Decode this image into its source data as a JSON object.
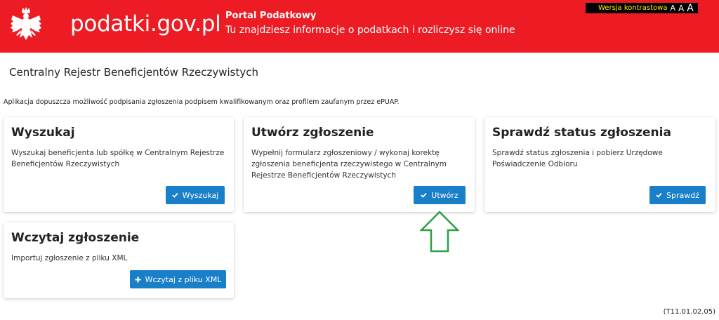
{
  "header": {
    "site_name": "podatki.gov.pl",
    "portal_title": "Portal Podatkowy",
    "portal_subtitle": "Tu znajdziesz informacje o podatkach i rozliczysz się online",
    "contrast_label": "Wersja kontrastowa",
    "font_sizes": [
      "A",
      "A",
      "A"
    ],
    "brand_color": "#ed1c24"
  },
  "page": {
    "title": "Centralny Rejestr Beneficjentów Rzeczywistych",
    "info": "Aplikacja dopuszcza możliwość podpisania zgłoszenia podpisem kwalifikowanym oraz profilem zaufanym przez ePUAP.",
    "version": "(T11.01.02.05)"
  },
  "cards": [
    {
      "title": "Wyszukaj",
      "desc_lines": [
        "Wyszukaj beneficjenta lub spółkę w Centralnym Rejestrze",
        "Beneficjentów Rzeczywistych"
      ],
      "button": "Wyszukaj",
      "button_icon": "check-icon"
    },
    {
      "title": "Utwórz zgłoszenie",
      "desc_lines": [
        "Wypełnij formularz zgłoszeniowy / wykonaj korektę",
        "zgłoszenia beneficjenta rzeczywistego w Centralnym",
        "Rejestrze Beneficjentów Rzeczywistych"
      ],
      "button": "Utwórz",
      "button_icon": "check-icon"
    },
    {
      "title": "Sprawdź status zgłoszenia",
      "desc_lines": [
        "Sprawdź status zgłoszenia i pobierz Urzędowe",
        "Poświadczenie Odbioru"
      ],
      "button": "Sprawdź",
      "button_icon": "check-icon"
    },
    {
      "title": "Wczytaj zgłoszenie",
      "desc_lines": [
        "Importuj zgłoszenie z pliku XML"
      ],
      "button": "Wczytaj z pliku XML",
      "button_icon": "plus-icon"
    }
  ],
  "colors": {
    "button": "#1a7fc9",
    "annotation_arrow": "#2ea043"
  }
}
